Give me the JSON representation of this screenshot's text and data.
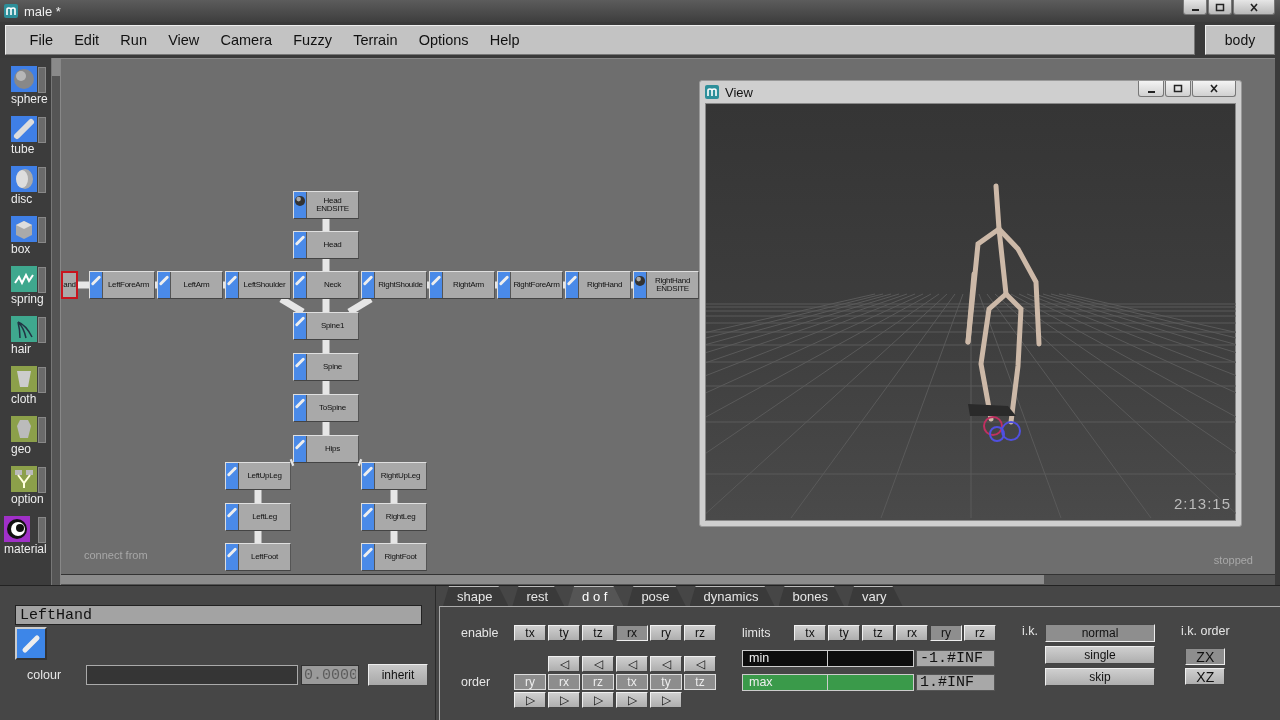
{
  "window": {
    "title": "male *"
  },
  "menu": [
    "File",
    "Edit",
    "Run",
    "View",
    "Camera",
    "Fuzzy",
    "Terrain",
    "Options",
    "Help"
  ],
  "body_button": "body",
  "tools": [
    {
      "label": "sphere",
      "color": "#3f7fe6"
    },
    {
      "label": "tube",
      "color": "#3f7fe6"
    },
    {
      "label": "disc",
      "color": "#3f7fe6"
    },
    {
      "label": "box",
      "color": "#3f7fe6"
    },
    {
      "label": "spring",
      "color": "#3fa88e"
    },
    {
      "label": "hair",
      "color": "#3fa88e"
    },
    {
      "label": "cloth",
      "color": "#8ca04a"
    },
    {
      "label": "geo",
      "color": "#8ca04a"
    },
    {
      "label": "option",
      "color": "#8ca04a"
    },
    {
      "label": "material",
      "color": "#a030c8"
    }
  ],
  "graph": {
    "root": {
      "label": "Hips",
      "kind": "tube",
      "selected": false,
      "children": [
        {
          "label": "ToSpine",
          "kind": "tube",
          "selected": false,
          "children": [
            {
              "label": "Spine",
              "kind": "tube",
              "selected": false,
              "children": [
                {
                  "label": "Spine1",
                  "kind": "tube",
                  "selected": false,
                  "children": [
                    {
                      "label": "LeftShoulder",
                      "kind": "tube",
                      "selected": false,
                      "children": [
                        {
                          "label": "LeftArm",
                          "kind": "tube",
                          "selected": false,
                          "children": [
                            {
                              "label": "LeftForeArm",
                              "kind": "tube",
                              "selected": false,
                              "children": [
                                {
                                  "label": "and",
                                  "kind": "cut",
                                  "selected": true
                                }
                              ]
                            }
                          ]
                        }
                      ]
                    },
                    {
                      "label": "Neck",
                      "kind": "tube",
                      "selected": false,
                      "children": [
                        {
                          "label": "Head",
                          "kind": "tube",
                          "selected": false,
                          "children": [
                            {
                              "label": "Head\nENDSITE",
                              "kind": "sphere",
                              "selected": false
                            }
                          ]
                        }
                      ]
                    },
                    {
                      "label": "RightShoulde",
                      "kind": "tube",
                      "selected": false,
                      "children": [
                        {
                          "label": "RightArm",
                          "kind": "tube",
                          "selected": false,
                          "children": [
                            {
                              "label": "RightForeArm",
                              "kind": "tube",
                              "selected": false,
                              "children": [
                                {
                                  "label": "RightHand",
                                  "kind": "tube",
                                  "selected": false,
                                  "children": [
                                    {
                                      "label": "RightHand\nENDSITE",
                                      "kind": "sphere",
                                      "selected": false
                                    }
                                  ]
                                }
                              ]
                            }
                          ]
                        }
                      ]
                    }
                  ]
                }
              ]
            }
          ]
        },
        {
          "label": "LeftUpLeg",
          "kind": "tube",
          "selected": false,
          "children": [
            {
              "label": "LeftLeg",
              "kind": "tube",
              "selected": false,
              "children": [
                {
                  "label": "LeftFoot",
                  "kind": "tube",
                  "selected": false
                }
              ]
            }
          ]
        },
        {
          "label": "RightUpLeg",
          "kind": "tube",
          "selected": false,
          "children": [
            {
              "label": "RightLeg",
              "kind": "tube",
              "selected": false,
              "children": [
                {
                  "label": "RightFoot",
                  "kind": "tube",
                  "selected": false
                }
              ]
            }
          ]
        }
      ]
    },
    "hint": "connect from",
    "status": "stopped"
  },
  "view": {
    "title": "View",
    "time": "2:13:15"
  },
  "properties": {
    "name": "LeftHand",
    "colour_label": "colour",
    "placeholder": "0.0000",
    "inherit": "inherit"
  },
  "tabs": [
    {
      "label": "shape",
      "selected": false
    },
    {
      "label": "rest",
      "selected": false
    },
    {
      "label": "d o f",
      "selected": true
    },
    {
      "label": "pose",
      "selected": false
    },
    {
      "label": "dynamics",
      "selected": false
    },
    {
      "label": "bones",
      "selected": false
    },
    {
      "label": "vary",
      "selected": false
    }
  ],
  "dof": {
    "enable_label": "enable",
    "enable": [
      {
        "label": "tx",
        "on": false
      },
      {
        "label": "ty",
        "on": false
      },
      {
        "label": "tz",
        "on": false
      },
      {
        "label": "rx",
        "on": true
      },
      {
        "label": "ry",
        "on": false
      },
      {
        "label": "rz",
        "on": false
      }
    ],
    "order_label": "order",
    "raise": [
      "◁",
      "◁",
      "◁",
      "◁",
      "◁"
    ],
    "order": [
      "ry",
      "rx",
      "rz",
      "tx",
      "ty",
      "tz"
    ],
    "lower": [
      "▷",
      "▷",
      "▷",
      "▷",
      "▷"
    ],
    "limits_label": "limits",
    "limits": [
      {
        "label": "tx",
        "selected": false
      },
      {
        "label": "ty",
        "selected": false
      },
      {
        "label": "tz",
        "selected": false
      },
      {
        "label": "rx",
        "selected": false
      },
      {
        "label": "ry",
        "selected": true
      },
      {
        "label": "rz",
        "selected": false
      }
    ],
    "min": {
      "label": "min",
      "level": 0,
      "value": "-1.#INF"
    },
    "max": {
      "label": "max",
      "level": 1,
      "value": "1.#INF"
    },
    "ik_label": "i.k.",
    "ik": [
      {
        "label": "normal",
        "selected": true
      },
      {
        "label": "single",
        "selected": false
      },
      {
        "label": "skip",
        "selected": false
      }
    ],
    "ik_order_label": "i.k. order",
    "ik_order": [
      {
        "label": "ZX",
        "selected": true
      },
      {
        "label": "XZ",
        "selected": false
      }
    ]
  }
}
